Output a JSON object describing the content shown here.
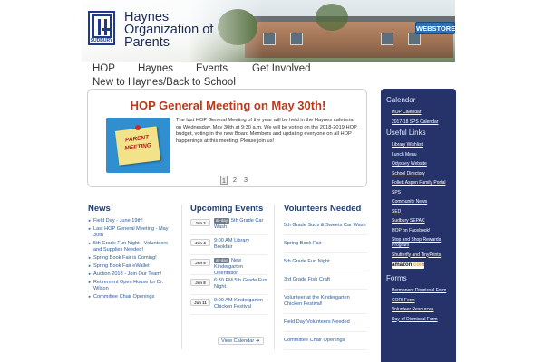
{
  "header": {
    "logo_sub": "SUDBURY",
    "title_lines": [
      "Haynes",
      "Organization of",
      "Parents"
    ],
    "webstore_label": "WEBSTORE"
  },
  "nav": {
    "items": [
      "HOP",
      "Haynes",
      "Events",
      "Get Involved",
      "New to Haynes/Back to School"
    ]
  },
  "feature": {
    "title": "HOP General Meeting on May 30th!",
    "image_text_1": "PARENT",
    "image_text_2": "MEETING",
    "body": "The last HOP General Meeting of the year will be held in the Haynes cafeteria on Wednesday, May 30th at 9:30 a.m. We will be voting on the 2018-2019 HOP budget, voting in the new Board Members and updating everyone on all HOP happenings at this meeting. Please join us!",
    "pages": [
      "1",
      "2",
      "3"
    ],
    "active_page": "1"
  },
  "news": {
    "heading": "News",
    "items": [
      "Field Day - June 19th!",
      "Last HOP General Meeting - May 30th",
      "5th Grade Fun Night - Volunteers and Supplies Needed!",
      "Spring Book Fair is Coming!",
      "Spring Book Fair eWallet",
      "Auction 2018 - Join Our Team!",
      "Retirement Open House for Dr. Wilson",
      "Committee Chair Openings"
    ]
  },
  "events": {
    "heading": "Upcoming Events",
    "allday_label": "all-day",
    "items": [
      {
        "date": "Jun 2",
        "allday": true,
        "text": "5th Grade Car Wash"
      },
      {
        "date": "Jun 4",
        "allday": false,
        "text": "9:00 AM Library Bookfair"
      },
      {
        "date": "Jun 5",
        "allday": true,
        "text": "New Kindergarten Orientation"
      },
      {
        "date": "Jun 8",
        "allday": false,
        "text": "6:30 PM 5th Grade Fun Night"
      },
      {
        "date": "Jun 11",
        "allday": false,
        "text": "9:00 AM Kindergarten Chicken Festival"
      }
    ],
    "view_calendar": "View Calendar ➔"
  },
  "volunteers": {
    "heading": "Volunteers Needed",
    "items": [
      "5th Grade Suds & Sweets Car Wash",
      "Spring Book Fair",
      "5th Grade Fun Night",
      "3rd Grade Fish Craft",
      "Volunteer at the Kindergarten Chicken Festival!",
      "Field Day Volunteers Needed",
      "Committee Chair Openings"
    ]
  },
  "sidebar": {
    "calendar_heading": "Calendar",
    "calendar_links": [
      "HOP Calendar",
      "2017-18 SPS Calendar"
    ],
    "useful_heading": "Useful Links",
    "useful_links": [
      "Library Wishlist",
      "Lunch Menu",
      "Odyssey Website",
      "School Directory",
      "Follett Aspen Family Portal",
      "SPS",
      "Community News",
      "SED",
      "Sudbury SEPAC",
      "HOP on Facebook!",
      "Stop and Shop Rewards Program",
      "Shutterfly and TinyPrints"
    ],
    "amazon_label": "amazon",
    "amazon_suffix": ".com",
    "forms_heading": "Forms",
    "forms_links": [
      "Permanent Dismissal Form",
      "CORI Form",
      "Volunteer Resources",
      "Day-of Dismissal Form"
    ]
  }
}
